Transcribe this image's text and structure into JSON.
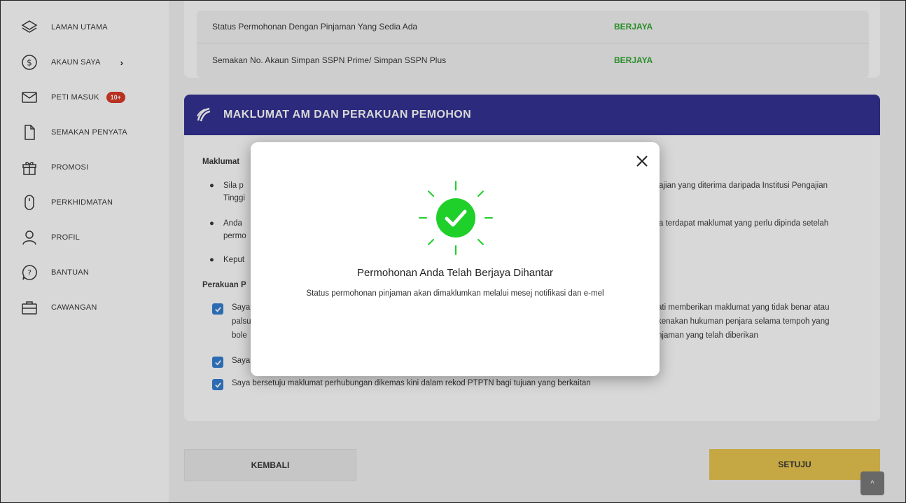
{
  "sidebar": {
    "items": [
      {
        "label": "LAMAN UTAMA",
        "icon": "layers-icon"
      },
      {
        "label": "AKAUN SAYA",
        "icon": "dollar-circle-icon",
        "chevron": "›"
      },
      {
        "label": "PETI MASUK",
        "icon": "mail-icon",
        "badge": "10+"
      },
      {
        "label": "SEMAKAN PENYATA",
        "icon": "document-icon"
      },
      {
        "label": "PROMOSI",
        "icon": "gift-icon"
      },
      {
        "label": "PERKHIDMATAN",
        "icon": "mouse-icon"
      },
      {
        "label": "PROFIL",
        "icon": "user-icon"
      },
      {
        "label": "BANTUAN",
        "icon": "help-icon"
      },
      {
        "label": "CAWANGAN",
        "icon": "briefcase-icon"
      }
    ]
  },
  "status": {
    "rows": [
      {
        "label": "Status Permohonan Dengan Pinjaman Yang Sedia Ada",
        "value": "BERJAYA"
      },
      {
        "label": "Semakan No. Akaun Simpan SSPN Prime/ Simpan SSPN Plus",
        "value": "BERJAYA"
      }
    ]
  },
  "section": {
    "title": "MAKLUMAT AM DAN PERAKUAN PEMOHON",
    "maklumat_heading": "Maklumat",
    "bullet1_left": "Sila p",
    "bullet1_left2": "Tinggi",
    "bullet1_right": "ajian yang diterima daripada Institusi Pengajian",
    "bullet2_left": "Anda",
    "bullet2_left2": "permo",
    "bullet2_right": "a terdapat maklumat yang perlu dipinda setelah",
    "bullet3_left": "Keput",
    "perakuan_heading": "Perakuan P",
    "cb1_left": "Saya",
    "cb1_left2": "palsu",
    "cb1_left3": "bole",
    "cb1_right": "ati memberikan maklumat yang tidak benar atau",
    "cb1_right2": "kenakan hukuman penjara selama tempoh yang",
    "cb1_right3": "njaman yang telah diberikan",
    "cb2_left": "Saya",
    "cb3": "Saya bersetuju maklumat perhubungan dikemas kini dalam rekod PTPTN bagi tujuan yang berkaitan"
  },
  "buttons": {
    "back": "KEMBALI",
    "agree": "SETUJU",
    "scroll_top": "^"
  },
  "modal": {
    "title": "Permohonan Anda Telah Berjaya Dihantar",
    "message": "Status permohonan pinjaman akan dimaklumkan melalui mesej notifikasi dan e-mel",
    "close_label": "×"
  },
  "colors": {
    "accent": "#2d2b8f",
    "success": "#2aa52a",
    "check_green": "#1fcf2a",
    "primary_button": "#e8c44a",
    "badge": "#d9341f"
  }
}
